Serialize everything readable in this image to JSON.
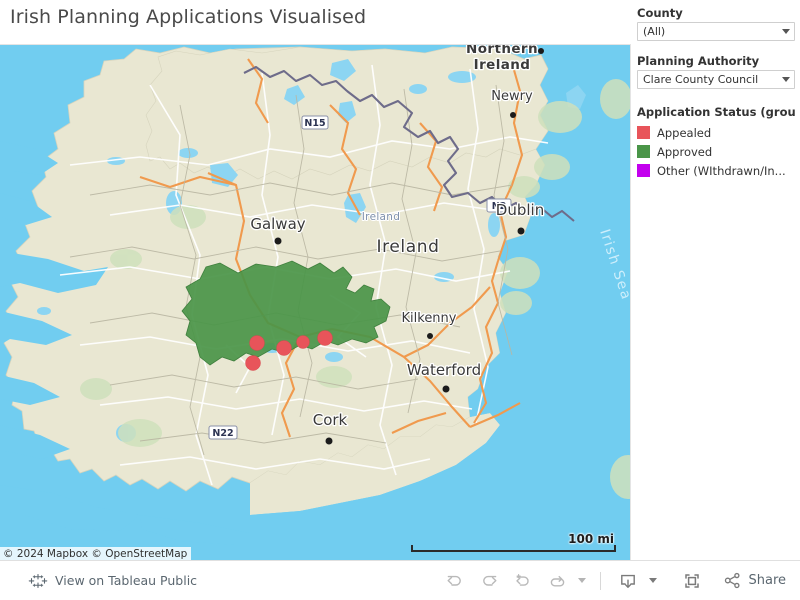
{
  "header": {
    "title": "Irish Planning Applications Visualised"
  },
  "controls": {
    "county": {
      "label": "County",
      "value": "(All)",
      "arrow_icon": "chevron-down-icon"
    },
    "planning_authority": {
      "label": "Planning Authority",
      "value": "Clare County Council",
      "arrow_icon": "chevron-down-icon"
    }
  },
  "legend": {
    "title": "Application Status (group...",
    "items": [
      {
        "label": "Appealed",
        "color": "#e8545a"
      },
      {
        "label": "Approved",
        "color": "#4a9548"
      },
      {
        "label": "Other (WIthdrawn/In...",
        "color": "#c300ee"
      }
    ]
  },
  "map": {
    "attribution": "© 2024 Mapbox  © OpenStreetMap",
    "scale_label": "100 mi",
    "ocean_color": "#71cdf0",
    "land_color": "#e9e7d2",
    "highlight_color": "#4a9548",
    "point_color": "#e8545a",
    "labels": {
      "country": "Ireland",
      "country_admin": "Ireland",
      "region": "Northern Ireland",
      "sea": "Irish Sea",
      "cities": [
        "Galway",
        "Dublin",
        "Newry",
        "Kilkenny",
        "Waterford",
        "Cork"
      ],
      "road_shields": [
        "N15",
        "N2",
        "N22"
      ]
    },
    "point_count": 5
  },
  "toolbar": {
    "tableau_link": "View on Tableau Public",
    "tableau_icon": "tableau-public-icon",
    "buttons": [
      {
        "name": "undo-button",
        "icon": "undo-icon"
      },
      {
        "name": "redo-button",
        "icon": "redo-icon"
      },
      {
        "name": "revert-button",
        "icon": "revert-icon"
      },
      {
        "name": "refresh-button",
        "icon": "refresh-icon"
      },
      {
        "name": "refresh-dropdown",
        "icon": "chevron-down-icon"
      },
      {
        "name": "download-button",
        "icon": "download-icon"
      },
      {
        "name": "download-dropdown",
        "icon": "chevron-down-icon"
      },
      {
        "name": "fullscreen-button",
        "icon": "fullscreen-icon"
      }
    ],
    "share": {
      "label": "Share",
      "icon": "share-icon"
    }
  }
}
